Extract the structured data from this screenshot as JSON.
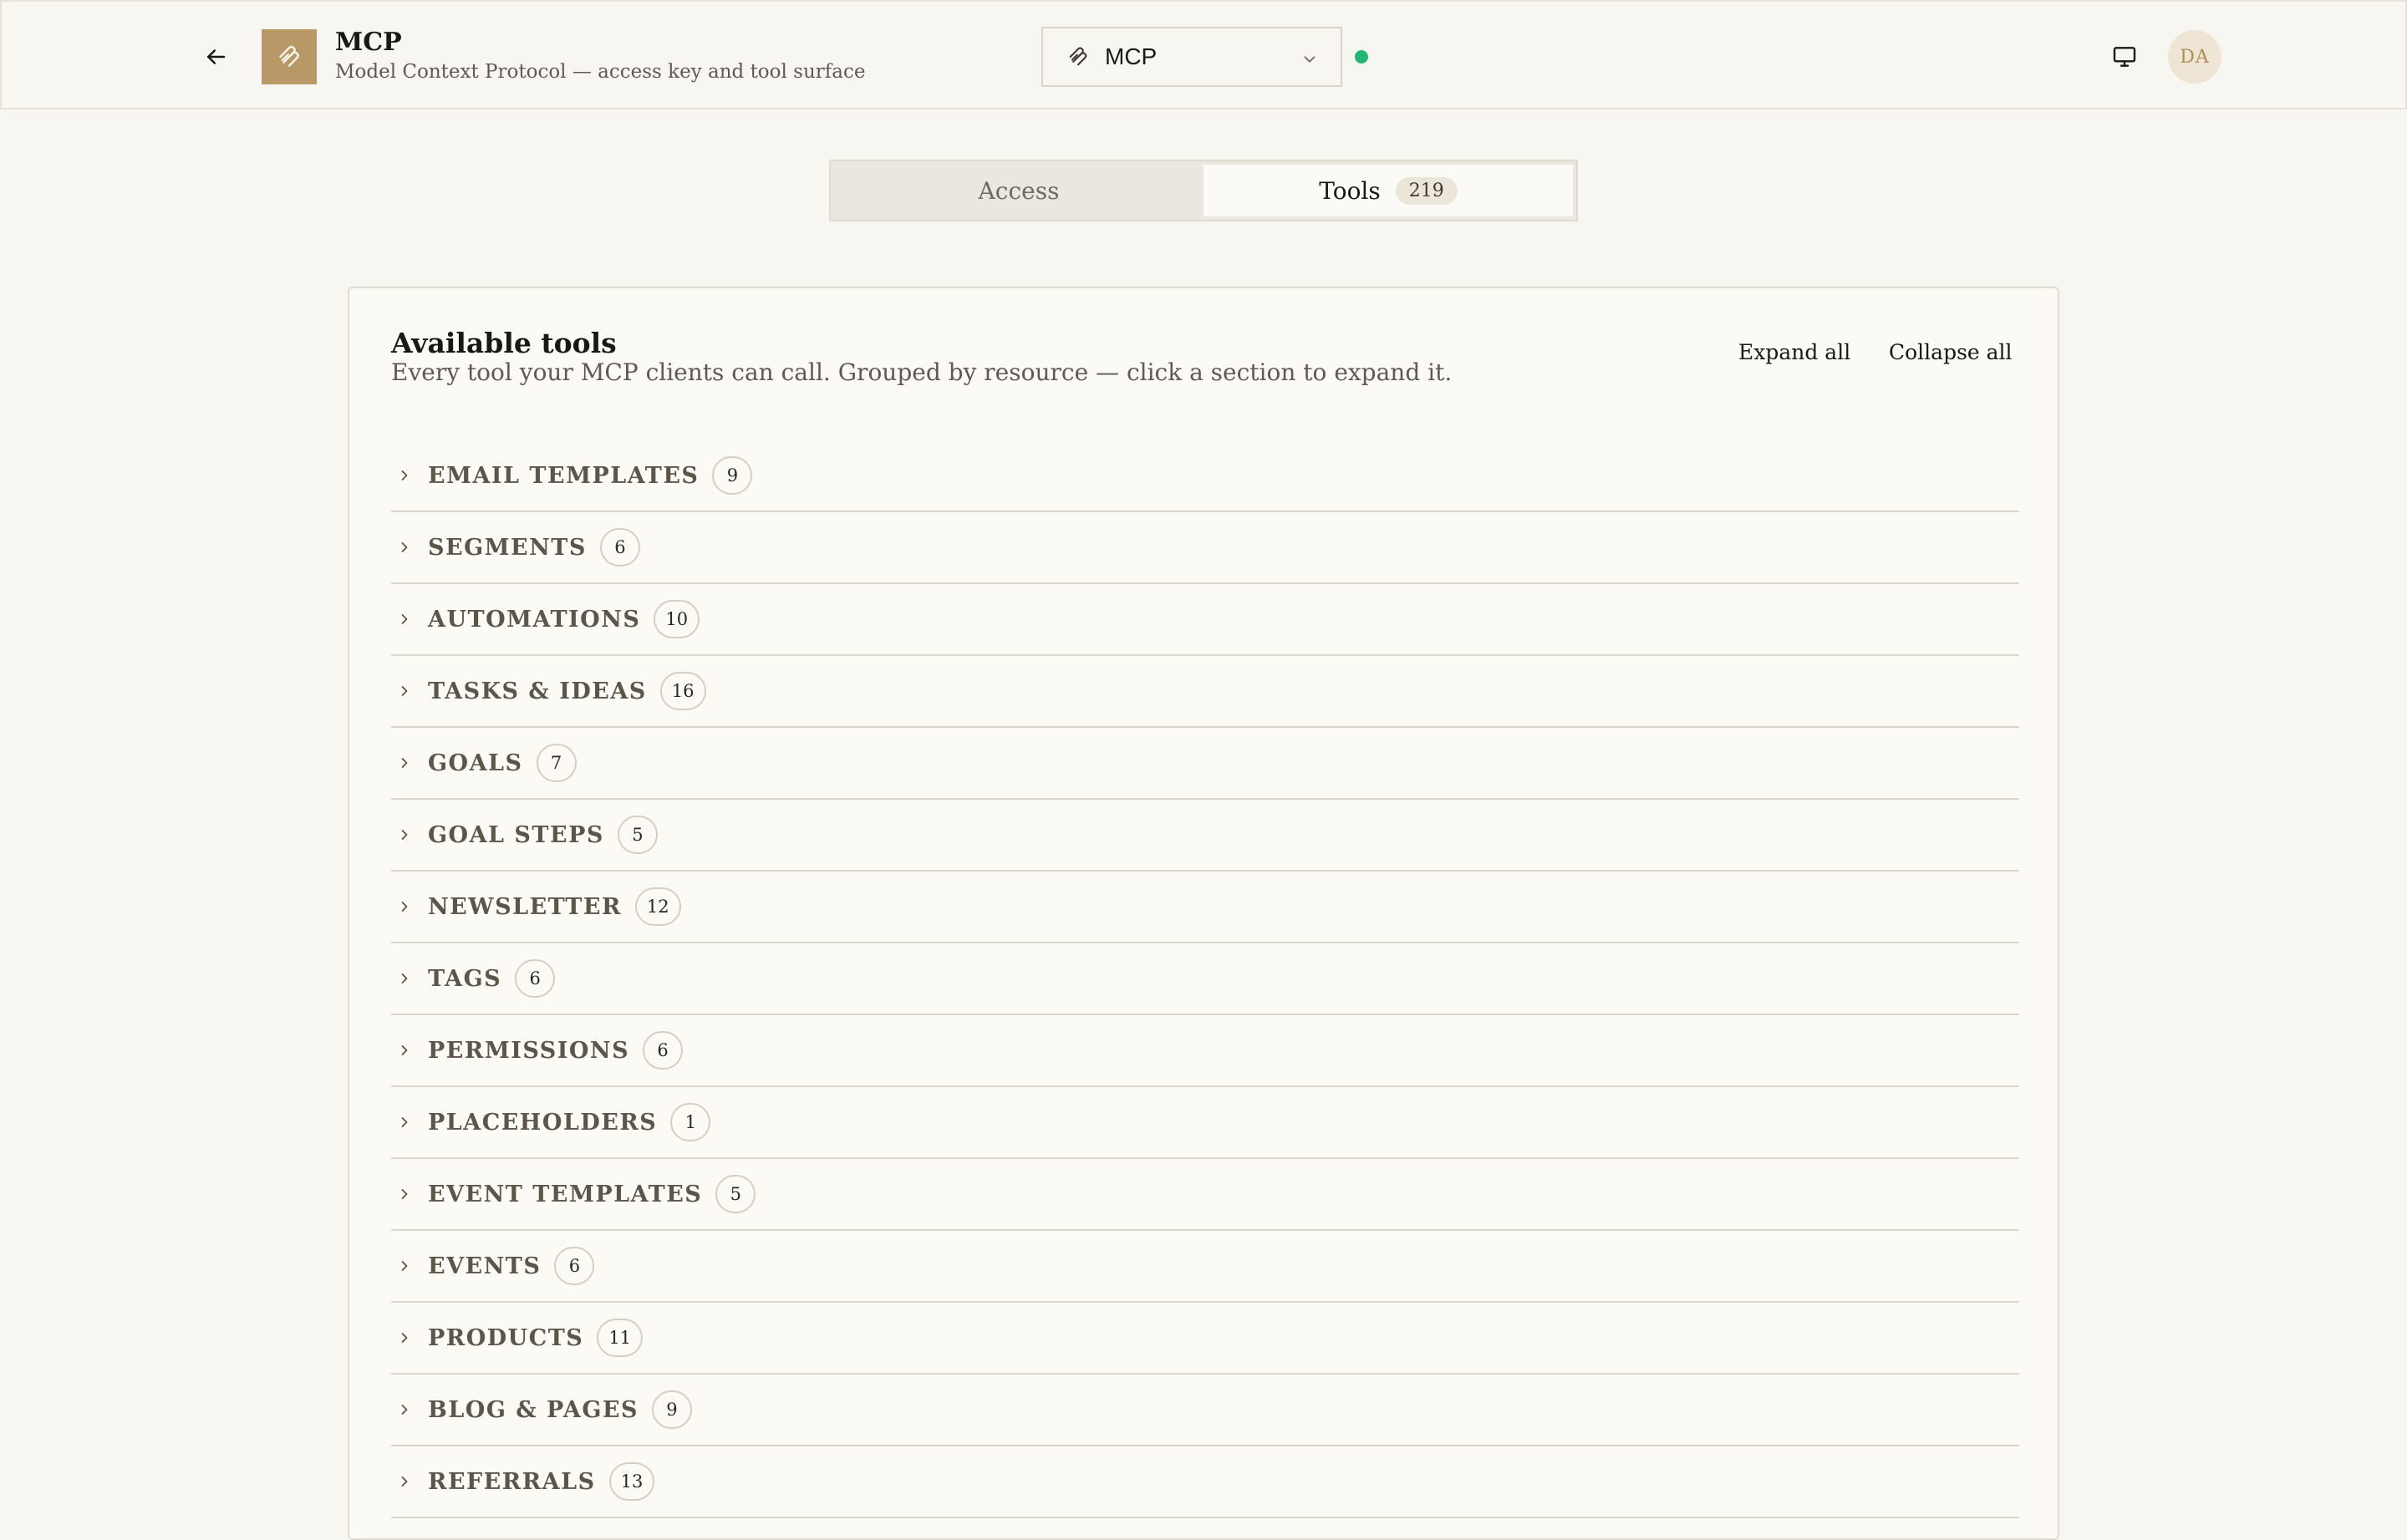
{
  "header": {
    "title": "MCP",
    "subtitle": "Model Context Protocol — access key and tool surface",
    "back_icon": "arrow-left-icon",
    "logo_icon": "mcp-logo-icon",
    "server_select": {
      "value": "MCP",
      "icon": "mcp-logo-icon"
    },
    "status": {
      "color": "#22b573",
      "state": "connected"
    },
    "monitor_icon": "monitor-icon",
    "avatar_initials": "DA"
  },
  "tabs": [
    {
      "label": "Access",
      "active": false
    },
    {
      "label": "Tools",
      "active": true,
      "count": "219"
    }
  ],
  "card": {
    "title": "Available tools",
    "subtitle": "Every tool your MCP clients can call. Grouped by resource — click a section to expand it.",
    "expand_all": "Expand all",
    "collapse_all": "Collapse all",
    "groups": [
      {
        "name": "EMAIL TEMPLATES",
        "count": "9"
      },
      {
        "name": "SEGMENTS",
        "count": "6"
      },
      {
        "name": "AUTOMATIONS",
        "count": "10"
      },
      {
        "name": "TASKS & IDEAS",
        "count": "16"
      },
      {
        "name": "GOALS",
        "count": "7"
      },
      {
        "name": "GOAL STEPS",
        "count": "5"
      },
      {
        "name": "NEWSLETTER",
        "count": "12"
      },
      {
        "name": "TAGS",
        "count": "6"
      },
      {
        "name": "PERMISSIONS",
        "count": "6"
      },
      {
        "name": "PLACEHOLDERS",
        "count": "1"
      },
      {
        "name": "EVENT TEMPLATES",
        "count": "5"
      },
      {
        "name": "EVENTS",
        "count": "6"
      },
      {
        "name": "PRODUCTS",
        "count": "11"
      },
      {
        "name": "BLOG & PAGES",
        "count": "9"
      },
      {
        "name": "REFERRALS",
        "count": "13"
      }
    ]
  },
  "colors": {
    "background": "#f8f6f0",
    "accent": "#b89866",
    "status_online": "#22b573"
  }
}
